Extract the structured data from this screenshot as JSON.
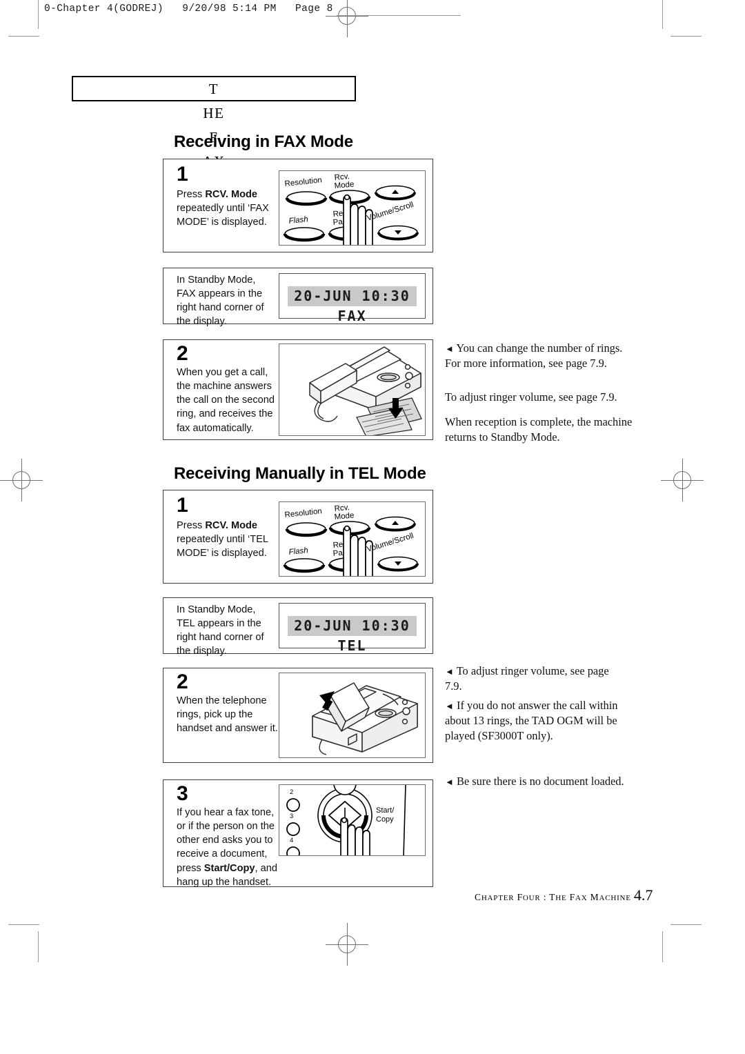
{
  "page": {
    "slug": "0-Chapter 4(GODREJ)   9/20/98 5:14 PM   Page 8",
    "running_head": "THE FAX MACHINE",
    "footer_text": "CHAPTER FOUR : THE FAX MACHINE",
    "footer_page": "4.7"
  },
  "sections": [
    {
      "heading": "Receiving in FAX Mode",
      "steps": [
        {
          "number": "1",
          "text_before": "Press ",
          "text_bold": "RCV. Mode",
          "text_after": " repeatedly until ‘FAX MODE’ is displayed.",
          "illustration": "control-panel"
        },
        {
          "number": "",
          "text": "In Standby Mode, FAX appears in the right hand corner of the display.",
          "lcd": "20-JUN 10:30 FAX",
          "illustration": "lcd-display"
        },
        {
          "number": "2",
          "text": "When you get a call, the machine answers the call on the second ring, and receives the fax automatically.",
          "illustration": "fax-machine-receiving"
        }
      ]
    },
    {
      "heading": "Receiving Manually in TEL Mode",
      "steps": [
        {
          "number": "1",
          "text_before": "Press ",
          "text_bold": "RCV. Mode",
          "text_after": " repeatedly until ‘TEL MODE’ is displayed.",
          "illustration": "control-panel"
        },
        {
          "number": "",
          "text": "In Standby Mode, TEL appears in the right hand corner of the display.",
          "lcd": "20-JUN 10:30 TEL",
          "illustration": "lcd-display"
        },
        {
          "number": "2",
          "text": "When the telephone rings, pick up the handset and answer it.",
          "illustration": "fax-machine-handset"
        },
        {
          "number": "3",
          "text_before": "If you hear a fax tone, or if the person on the other end asks you to receive a document, press ",
          "text_bold": "Start/Copy",
          "text_after": ", and hang up the handset.",
          "illustration": "start-copy-panel"
        }
      ]
    }
  ],
  "control_panel": {
    "buttons": [
      {
        "label": "Resolution"
      },
      {
        "label": "Rcv. Mode"
      },
      {
        "label": "Flash"
      },
      {
        "label": "Redial/ Pause"
      },
      {
        "label": "Volume/Scroll"
      }
    ],
    "scroll_up": "▲",
    "scroll_down": "▼"
  },
  "start_copy_panel": {
    "speed_dial_labels": [
      "2",
      "3",
      "4"
    ],
    "button_label": "Start/ Copy"
  },
  "notes_fax": [
    {
      "bullet": "◄",
      "text": "You can change the number of rings. For more information, see page 7.9."
    },
    {
      "bullet": "",
      "text": "To adjust ringer volume, see page 7.9."
    },
    {
      "bullet": "",
      "text": "When reception is complete, the machine returns to Standby Mode."
    }
  ],
  "notes_tel": [
    {
      "bullet": "◄",
      "text": "To adjust ringer volume, see page 7.9."
    },
    {
      "bullet": "◄",
      "text": "If you do not answer the call within about 13 rings, the TAD OGM will be played (SF3000T only)."
    },
    {
      "bullet": "◄",
      "text": "Be sure there is no document loaded."
    }
  ]
}
